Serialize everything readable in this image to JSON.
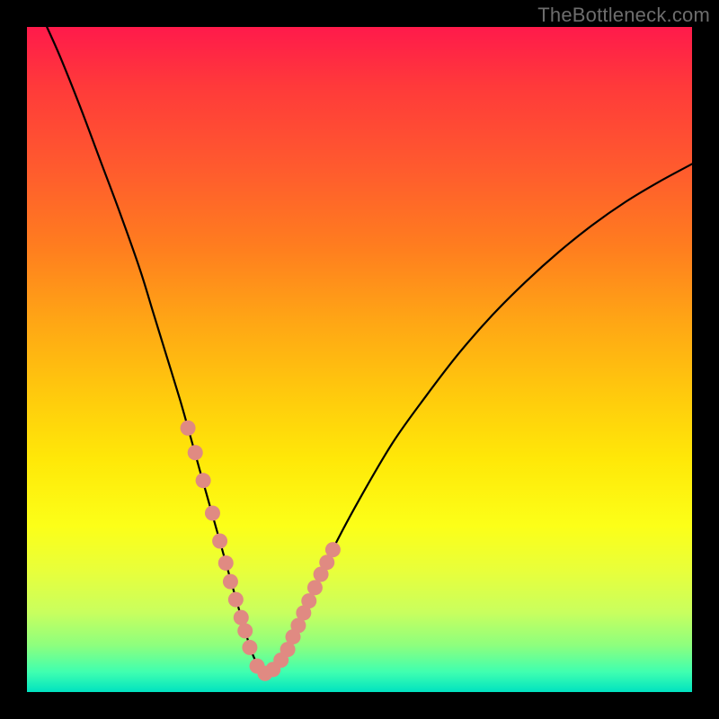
{
  "attribution": "TheBottleneck.com",
  "chart_data": {
    "type": "line",
    "title": "",
    "xlabel": "",
    "ylabel": "",
    "xlim": [
      0,
      100
    ],
    "ylim": [
      0,
      100
    ],
    "curve": {
      "x": [
        3,
        5,
        8,
        11,
        14,
        17,
        19,
        21,
        23,
        24.5,
        26,
        27.5,
        29,
        30.5,
        32,
        33,
        34,
        35,
        36,
        37.5,
        39,
        41,
        43,
        46,
        50,
        55,
        60,
        65,
        70,
        75,
        80,
        85,
        90,
        95,
        100
      ],
      "y": [
        100,
        95.5,
        88,
        80,
        72,
        63.5,
        57,
        50.5,
        44,
        38.7,
        33.3,
        28,
        22.7,
        17.3,
        12,
        8.5,
        5.5,
        3.5,
        2.2,
        3.5,
        6,
        10.5,
        15,
        21.5,
        29,
        37.5,
        44.5,
        51,
        56.7,
        61.7,
        66.2,
        70.2,
        73.7,
        76.7,
        79.4
      ]
    },
    "markers": {
      "x": [
        24.2,
        25.3,
        26.5,
        27.9,
        29.0,
        29.9,
        30.6,
        31.4,
        32.2,
        32.8,
        33.5,
        34.6,
        35.8,
        37.0,
        38.2,
        39.2,
        40.0,
        40.8,
        41.6,
        42.4,
        43.3,
        44.2,
        45.1,
        46.0
      ],
      "y": [
        39.7,
        36.0,
        31.8,
        26.9,
        22.7,
        19.4,
        16.6,
        13.9,
        11.2,
        9.2,
        6.7,
        3.9,
        2.8,
        3.4,
        4.8,
        6.4,
        8.3,
        10.0,
        11.9,
        13.7,
        15.7,
        17.7,
        19.5,
        21.4
      ]
    },
    "marker_color": "#e08a82",
    "curve_color": "#000000"
  }
}
